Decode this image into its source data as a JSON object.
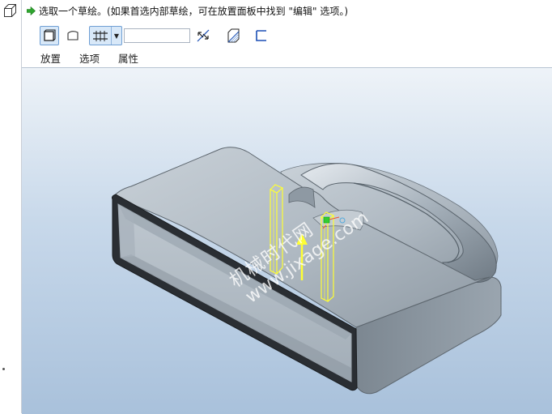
{
  "prompt": {
    "message": "选取一个草绘。(如果首选内部草绘，可在放置面板中找到 \"编辑\" 选项。)"
  },
  "toolbar": {
    "depth_value": ""
  },
  "tabs": [
    {
      "label": "放置"
    },
    {
      "label": "选项"
    },
    {
      "label": "属性"
    }
  ],
  "watermark": {
    "line1": "机械时代网",
    "line2": "www.jixage.com"
  },
  "colors": {
    "accent": "#6f9fd4",
    "prompt_arrow": "#2fa52f",
    "sketch_highlight": "#ffff33",
    "model_body": "#a9b4bd"
  },
  "icons": [
    "feature-icon",
    "green-arrow-icon",
    "solid-icon",
    "surface-icon",
    "blind-depth-icon",
    "flip-direction-icon",
    "remove-material-icon",
    "thicken-icon"
  ]
}
